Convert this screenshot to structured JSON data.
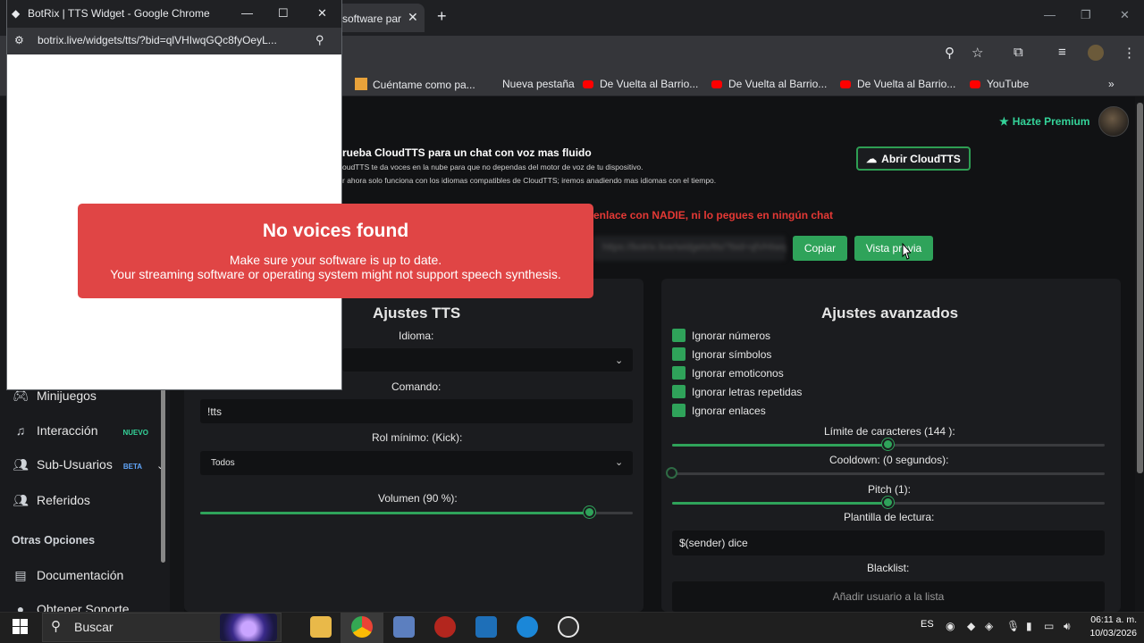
{
  "browser": {
    "active_tab_title": "software par",
    "bookmarks": [
      "Cuéntame como pa...",
      "Nueva pestaña",
      "De Vuelta al Barrio...",
      "De Vuelta al Barrio...",
      "De Vuelta al Barrio...",
      "YouTube"
    ]
  },
  "popup": {
    "window_title": "BotRix | TTS Widget - Google Chrome",
    "url": "botrix.live/widgets/tts/?bid=qlVHIwqGQc8fyOeyL...",
    "error": {
      "title": "No voices found",
      "line1": "Make sure your software is up to date.",
      "line2": "Your streaming software or operating system might not support speech synthesis."
    }
  },
  "sidebar": {
    "items": [
      {
        "label": "Minijuegos",
        "icon": "gamepad-icon"
      },
      {
        "label": "Interacción",
        "icon": "music-icon",
        "badge": "NUEVO"
      },
      {
        "label": "Sub-Usuarios",
        "icon": "users-icon",
        "badge": "BETA"
      },
      {
        "label": "Referidos",
        "icon": "users-icon"
      }
    ],
    "section_title": "Otras Opciones",
    "section_items": [
      {
        "label": "Documentación",
        "icon": "document-icon"
      },
      {
        "label": "Obtener Soporte",
        "icon": "support-icon"
      }
    ]
  },
  "header": {
    "premium_label": "Hazte Premium"
  },
  "cloudtts": {
    "title": "rueba CloudTTS para un chat con voz mas fluido",
    "line1": "oudTTS te da voces en la nube para que no dependas del motor de voz de tu dispositivo.",
    "line2": "r ahora solo funciona con los idiomas compatibles de CloudTTS; iremos anadiendo mas idiomas con el tiempo.",
    "button_label": "Abrir CloudTTS"
  },
  "link_section": {
    "warning": "enlace con NADIE, ni lo pegues en ningún chat",
    "url_blurred": "https://botrix.live/widgets/tts/?bid=qlVHIwqGQc8fyOeyL",
    "copy_label": "Copiar",
    "preview_label": "Vista previa"
  },
  "tts_settings": {
    "title": "Ajustes TTS",
    "language_label": "Idioma:",
    "language_value": "",
    "command_label": "Comando:",
    "command_value": "!tts",
    "min_role_label": "Rol mínimo: (Kick):",
    "min_role_value": "Todos",
    "volume_label": "Volumen (90 %):",
    "volume_value": 0.9
  },
  "advanced": {
    "title": "Ajustes avanzados",
    "checkboxes": [
      "Ignorar números",
      "Ignorar símbolos",
      "Ignorar emoticonos",
      "Ignorar letras repetidas",
      "Ignorar enlaces"
    ],
    "char_limit_label": "Límite de caracteres (144 ):",
    "char_limit_fraction": 0.5,
    "cooldown_label": "Cooldown: (0 segundos):",
    "cooldown_fraction": 0.0,
    "pitch_label": "Pitch (1):",
    "pitch_fraction": 0.5,
    "template_label": "Plantilla de lectura:",
    "template_value": "$(sender) dice",
    "blacklist_label": "Blacklist:",
    "blacklist_placeholder": "Añadir usuario a la lista"
  },
  "taskbar": {
    "search_label": "Buscar",
    "lang": "ES",
    "time": "06:11 a. m.",
    "date": "10/03/2026"
  },
  "colors": {
    "accent_green": "#2fa35a",
    "premium_green": "#34d399",
    "error_red": "#e04545",
    "warning_red": "#e53935"
  }
}
